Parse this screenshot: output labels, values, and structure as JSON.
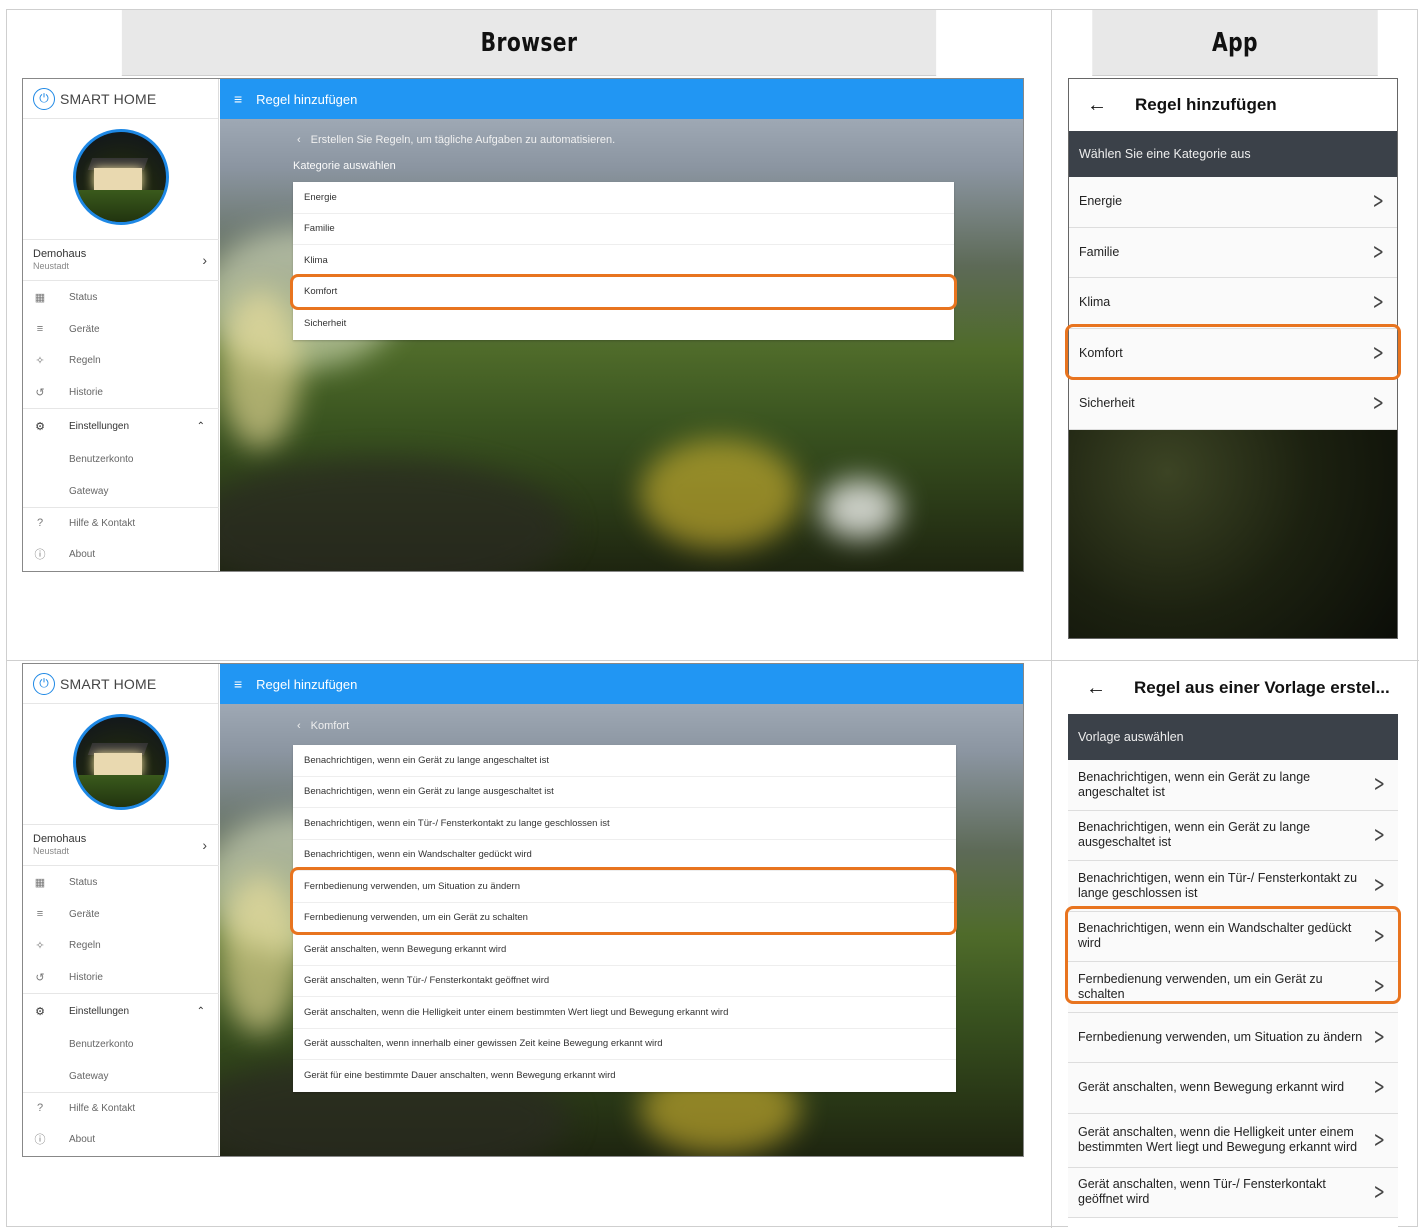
{
  "headers": {
    "browser": "Browser",
    "app": "App"
  },
  "browser": {
    "logo": "SMART HOME",
    "logo_icon": "power-icon",
    "place_name": "Demohaus",
    "place_city": "Neustadt",
    "menu": [
      {
        "icon": "▦",
        "label": "Status"
      },
      {
        "icon": "≡",
        "label": "Geräte"
      },
      {
        "icon": "✧",
        "label": "Regeln"
      },
      {
        "icon": "↺",
        "label": "Historie"
      }
    ],
    "settings_label": "Einstellungen",
    "settings_sub": [
      "Benutzerkonto",
      "Gateway"
    ],
    "help_label": "Hilfe & Kontakt",
    "about_label": "About",
    "topbar_title": "Regel hinzufügen",
    "top": {
      "crumb": "Erstellen Sie Regeln, um tägliche Aufgaben zu automatisieren.",
      "category_heading": "Kategorie auswählen",
      "items": [
        "Energie",
        "Familie",
        "Klima",
        "Komfort",
        "Sicherheit"
      ]
    },
    "bottom": {
      "crumb": "Komfort",
      "items": [
        "Benachrichtigen, wenn ein Gerät zu lange angeschaltet ist",
        "Benachrichtigen, wenn ein Gerät zu lange ausgeschaltet ist",
        "Benachrichtigen, wenn ein Tür-/ Fensterkontakt zu lange geschlossen ist",
        "Benachrichtigen, wenn ein Wandschalter gedückt wird",
        "Fernbedienung verwenden, um Situation zu ändern",
        "Fernbedienung verwenden, um ein Gerät zu schalten",
        "Gerät anschalten, wenn Bewegung erkannt wird",
        "Gerät anschalten, wenn Tür-/ Fensterkontakt geöffnet wird",
        "Gerät anschalten, wenn die Helligkeit unter einem bestimmten Wert liegt und Bewegung erkannt wird",
        "Gerät ausschalten, wenn innerhalb einer gewissen Zeit keine Bewegung erkannt wird",
        "Gerät für eine bestimmte Dauer anschalten, wenn Bewegung erkannt wird"
      ]
    }
  },
  "app": {
    "top": {
      "title": "Regel hinzufügen",
      "heading": "Wählen Sie eine Kategorie aus",
      "items": [
        "Energie",
        "Familie",
        "Klima",
        "Komfort",
        "Sicherheit"
      ]
    },
    "bottom": {
      "title": "Regel aus einer Vorlage erstel...",
      "heading": "Vorlage auswählen",
      "items": [
        "Benachrichtigen, wenn ein Gerät zu lange angeschaltet ist",
        "Benachrichtigen, wenn ein Gerät zu lange ausgeschaltet ist",
        "Benachrichtigen, wenn ein Tür-/ Fensterkontakt zu lange geschlossen ist",
        "Benachrichtigen, wenn ein Wandschalter gedückt wird",
        "Fernbedienung verwenden, um ein Gerät zu schalten",
        "Fernbedienung verwenden, um Situation zu ändern",
        "Gerät anschalten, wenn Bewegung erkannt wird",
        "Gerät anschalten, wenn die Helligkeit unter einem bestimmten Wert liegt und Bewegung erkannt wird",
        "Gerät anschalten, wenn Tür-/ Fensterkontakt geöffnet wird"
      ]
    }
  },
  "colors": {
    "accent": "#2196f3",
    "highlight": "#e8741f",
    "app_header": "#3b4149"
  }
}
